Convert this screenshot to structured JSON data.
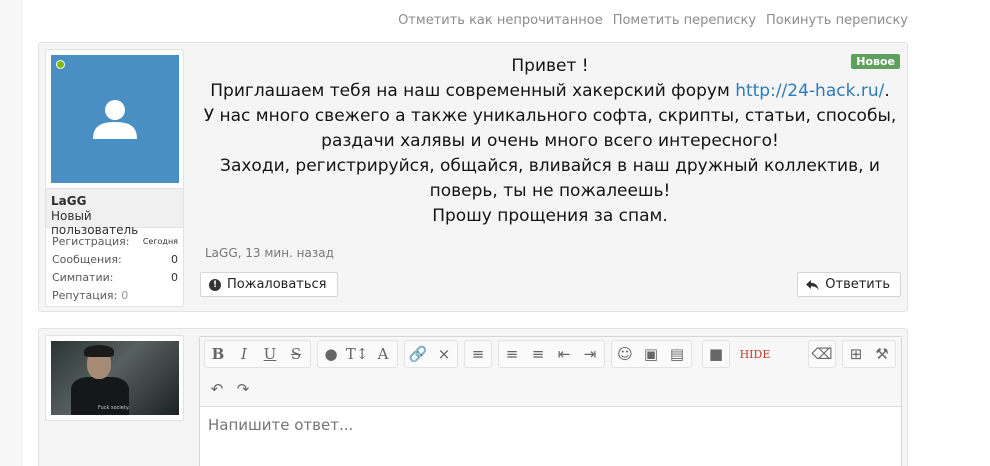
{
  "thread_actions": [
    "Отметить как непрочитанное",
    "Пометить переписку",
    "Покинуть переписку"
  ],
  "message": {
    "badge": "Новое",
    "lines": [
      "Привет !",
      "Приглашаем тебя на наш современный хакерский форум ",
      "У нас много свежего а также уникального софта, скрипты, статьи, способы,",
      "раздачи халявы и очень много всего интересного!",
      "Заходи, регистрируйся, общайся, вливайся в наш дружный коллектив, и",
      "поверь, ты не пожалеешь!",
      "Прошу прощения за спам."
    ],
    "link": "http://24-hack.ru/",
    "link_suffix": ".",
    "meta": "LaGG, 13 мин. назад",
    "report_label": "Пожаловаться",
    "reply_label": "Ответить"
  },
  "user": {
    "name": "LaGG",
    "title": "Новый пользователь",
    "stats": [
      {
        "label": "Регистрация:",
        "value": "Сегодня"
      },
      {
        "label": "Сообщения:",
        "value": "0"
      },
      {
        "label": "Симпатии:",
        "value": "0"
      },
      {
        "label": "Репутация:",
        "value": "0"
      }
    ]
  },
  "reply_avatar_caption": "Fuck society.",
  "editor": {
    "placeholder": "Напишите ответ...",
    "hide_label": "HIDE"
  },
  "colors": {
    "avatar_bg": "#4a8fc4",
    "online": "#7fb900",
    "badge": "#5fa05f",
    "link": "#2b7bb9"
  }
}
